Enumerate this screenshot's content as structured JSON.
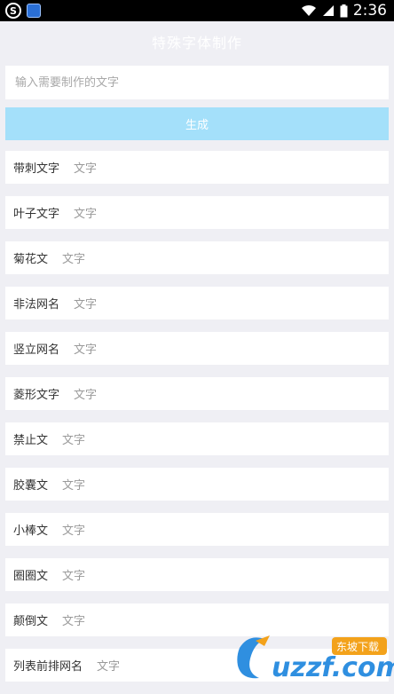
{
  "status_bar": {
    "time": "2:36",
    "icons": [
      "sogou-icon",
      "app-icon",
      "wifi-icon",
      "signal-icon",
      "battery-icon"
    ]
  },
  "header": {
    "title": "特殊字体制作"
  },
  "input": {
    "placeholder": "输入需要制作的文字",
    "value": ""
  },
  "generate_button": {
    "label": "生成"
  },
  "colors": {
    "background": "#efeff4",
    "button": "#a4e0fa",
    "item_bg": "#ffffff"
  },
  "items": [
    {
      "name": "带刺文字",
      "preview": "文字"
    },
    {
      "name": "叶子文字",
      "preview": "文字"
    },
    {
      "name": "菊花文",
      "preview": "文字"
    },
    {
      "name": "非法网名",
      "preview": "文字"
    },
    {
      "name": "竖立网名",
      "preview": "文字"
    },
    {
      "name": "菱形文字",
      "preview": "文字"
    },
    {
      "name": "禁止文",
      "preview": "文字"
    },
    {
      "name": "胶囊文",
      "preview": "文字"
    },
    {
      "name": "小棒文",
      "preview": "文字"
    },
    {
      "name": "圈圈文",
      "preview": "文字"
    },
    {
      "name": "颠倒文",
      "preview": "文字"
    },
    {
      "name": "列表前排网名",
      "preview": "文字"
    }
  ],
  "watermark": {
    "brand": "uzzf.com",
    "tag": "东坡下载"
  }
}
